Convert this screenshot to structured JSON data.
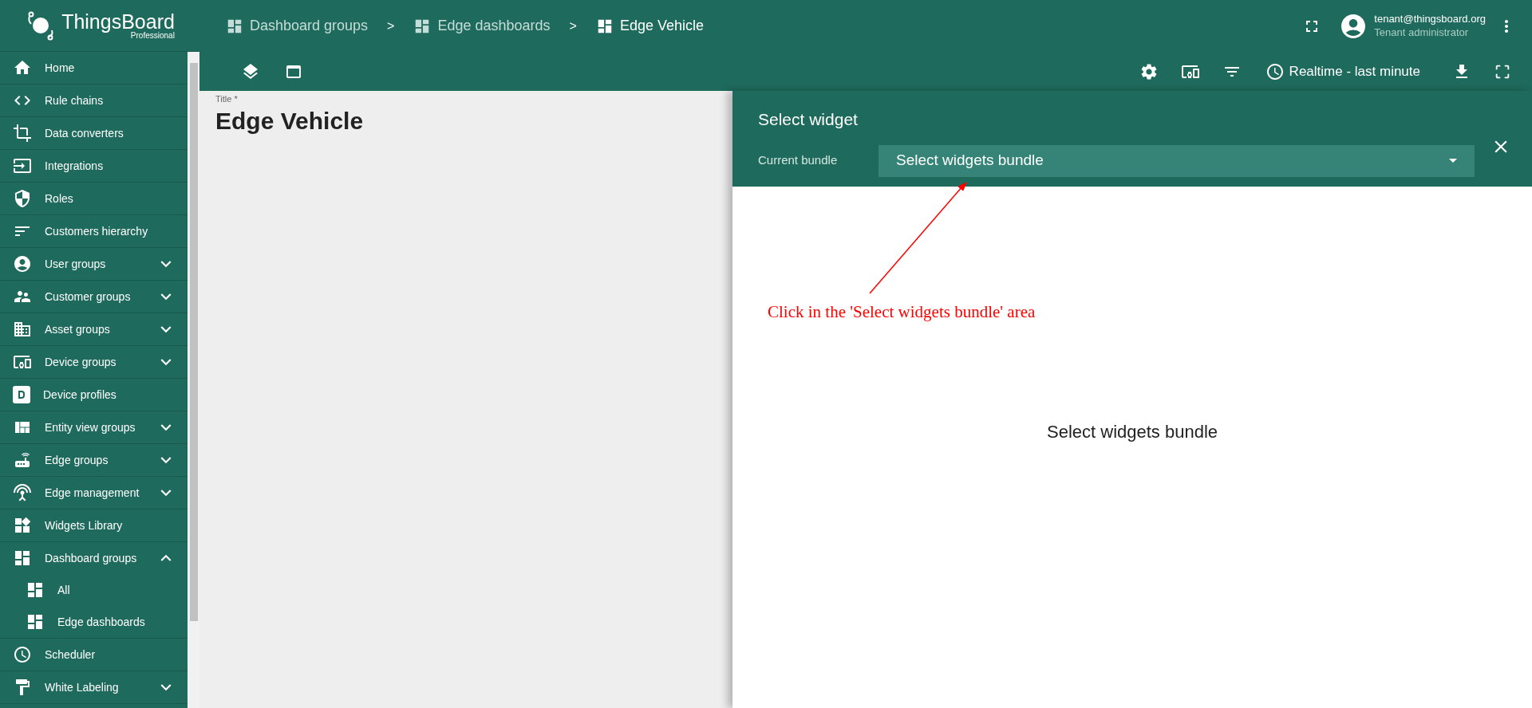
{
  "logo": {
    "name": "ThingsBoard",
    "edition": "Professional"
  },
  "sidebar": {
    "items": [
      {
        "label": "Home",
        "kind": "link"
      },
      {
        "label": "Rule chains",
        "kind": "link"
      },
      {
        "label": "Data converters",
        "kind": "link"
      },
      {
        "label": "Integrations",
        "kind": "link"
      },
      {
        "label": "Roles",
        "kind": "link"
      },
      {
        "label": "Customers hierarchy",
        "kind": "link"
      },
      {
        "label": "User groups",
        "kind": "group",
        "expanded": false
      },
      {
        "label": "Customer groups",
        "kind": "group",
        "expanded": false
      },
      {
        "label": "Asset groups",
        "kind": "group",
        "expanded": false
      },
      {
        "label": "Device groups",
        "kind": "group",
        "expanded": false
      },
      {
        "label": "Device profiles",
        "kind": "link"
      },
      {
        "label": "Entity view groups",
        "kind": "group",
        "expanded": false
      },
      {
        "label": "Edge groups",
        "kind": "group",
        "expanded": false
      },
      {
        "label": "Edge management",
        "kind": "group",
        "expanded": false
      },
      {
        "label": "Widgets Library",
        "kind": "link"
      },
      {
        "label": "Dashboard groups",
        "kind": "group",
        "expanded": true,
        "children": [
          {
            "label": "All"
          },
          {
            "label": "Edge dashboards"
          }
        ]
      },
      {
        "label": "Scheduler",
        "kind": "link"
      },
      {
        "label": "White Labeling",
        "kind": "group",
        "expanded": false
      }
    ]
  },
  "breadcrumbs": [
    {
      "label": "Dashboard groups",
      "selected": false
    },
    {
      "label": "Edge dashboards",
      "selected": false
    },
    {
      "label": "Edge Vehicle",
      "selected": true
    }
  ],
  "breadcrumb_separator": ">",
  "user": {
    "email": "tenant@thingsboard.org",
    "role": "Tenant administrator"
  },
  "toolbar": {
    "timewindow": "Realtime - last minute"
  },
  "dashboard": {
    "title_label": "Title *",
    "title": "Edge Vehicle"
  },
  "panel": {
    "title": "Select widget",
    "bundle_label": "Current bundle",
    "bundle_placeholder": "Select widgets bundle",
    "empty_message": "Select widgets bundle",
    "annotation": "Click in the 'Select widgets bundle' area"
  }
}
